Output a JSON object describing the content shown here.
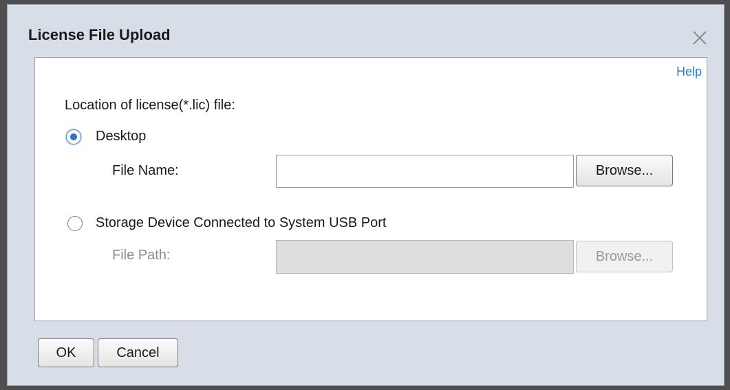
{
  "dialog": {
    "title": "License File Upload",
    "close_icon": "close-icon",
    "help_label": "Help"
  },
  "form": {
    "location_label": "Location of license(*.lic) file:",
    "desktop": {
      "label": "Desktop",
      "checked": true,
      "file_name_label": "File Name:",
      "file_name_value": "",
      "browse_label": "Browse..."
    },
    "usb": {
      "label": "Storage Device Connected to System USB Port",
      "checked": false,
      "file_path_label": "File Path:",
      "file_path_value": "",
      "browse_label": "Browse...",
      "disabled": true
    }
  },
  "footer": {
    "ok_label": "OK",
    "cancel_label": "Cancel"
  },
  "colors": {
    "link": "#2a7ec3",
    "radio_selected": "#2a6fc9",
    "dialog_bg": "#d8dee7"
  }
}
